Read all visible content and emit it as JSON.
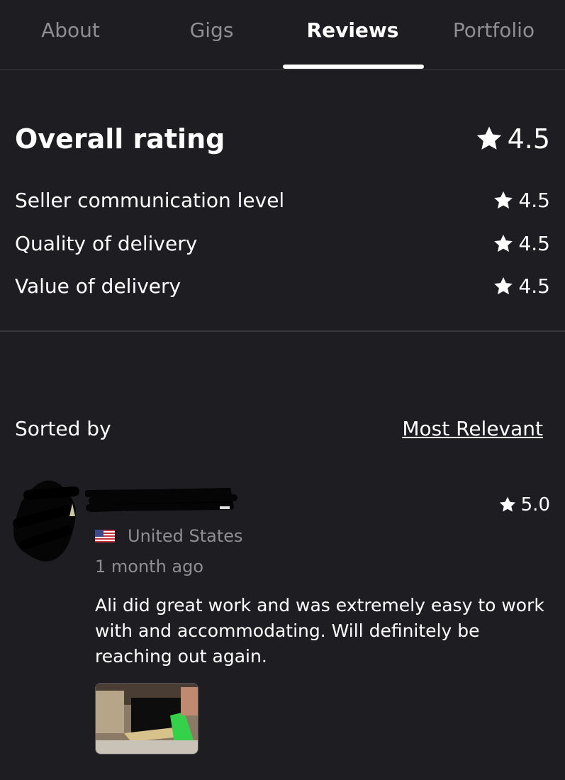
{
  "tabs": [
    {
      "label": "About"
    },
    {
      "label": "Gigs"
    },
    {
      "label": "Reviews"
    },
    {
      "label": "Portfolio"
    }
  ],
  "active_tab": "Reviews",
  "overall": {
    "label": "Overall rating",
    "value": "4.5"
  },
  "breakdown": [
    {
      "label": "Seller communication level",
      "value": "4.5"
    },
    {
      "label": "Quality of delivery",
      "value": "4.5"
    },
    {
      "label": "Value of delivery",
      "value": "4.5"
    }
  ],
  "sort": {
    "label": "Sorted by",
    "value": "Most Relevant"
  },
  "review": {
    "rating": "5.0",
    "country": "United States",
    "time": "1 month ago",
    "text": "Ali did great work and was extremely easy to work with and accommodating. Will definitely be reaching out again."
  },
  "icons": {
    "star": "star-icon",
    "flag": "us-flag-icon"
  },
  "colors": {
    "background": "#1e1e22",
    "muted": "#8e8e93",
    "divider": "#38383c"
  }
}
